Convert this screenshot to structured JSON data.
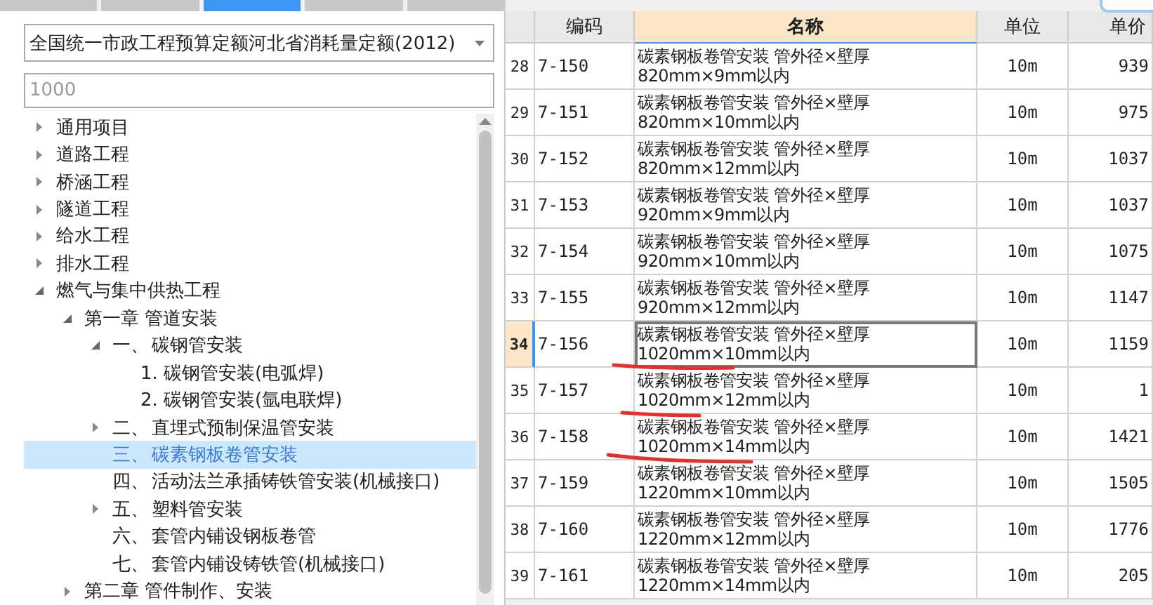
{
  "tabs": [
    {
      "selected": false
    },
    {
      "selected": false
    },
    {
      "selected": true
    },
    {
      "selected": false
    },
    {
      "selected": false
    }
  ],
  "library_select": {
    "value": "全国统一市政工程预算定额河北省消耗量定额(2012)"
  },
  "search": {
    "placeholder": "1000"
  },
  "tree": [
    {
      "label": "通用项目",
      "expanded": false,
      "has_children": true
    },
    {
      "label": "道路工程",
      "expanded": false,
      "has_children": true
    },
    {
      "label": "桥涵工程",
      "expanded": false,
      "has_children": true
    },
    {
      "label": "隧道工程",
      "expanded": false,
      "has_children": true
    },
    {
      "label": "给水工程",
      "expanded": false,
      "has_children": true
    },
    {
      "label": "排水工程",
      "expanded": false,
      "has_children": true
    },
    {
      "label": "燃气与集中供热工程",
      "expanded": true,
      "has_children": true,
      "children": [
        {
          "label": "第一章 管道安装",
          "expanded": true,
          "has_children": true,
          "children": [
            {
              "number": "一、",
              "label": "碳钢管安装",
              "expanded": true,
              "has_children": true,
              "children": [
                {
                  "label": "1. 碳钢管安装(电弧焊)",
                  "has_children": false
                },
                {
                  "label": "2. 碳钢管安装(氩电联焊)",
                  "has_children": false
                }
              ]
            },
            {
              "number": "二、",
              "label": "直埋式预制保温管安装",
              "expanded": false,
              "has_children": true
            },
            {
              "number": "三、",
              "label": "碳素钢板卷管安装",
              "has_children": false,
              "selected": true
            },
            {
              "number": "四、",
              "label": "活动法兰承插铸铁管安装(机械接口)",
              "has_children": false
            },
            {
              "number": "五、",
              "label": "塑料管安装",
              "expanded": false,
              "has_children": true
            },
            {
              "number": "六、",
              "label": "套管内铺设钢板卷管",
              "has_children": false
            },
            {
              "number": "七、",
              "label": "套管内铺设铸铁管(机械接口)",
              "has_children": false
            }
          ]
        },
        {
          "label": "第二章 管件制作、安装",
          "expanded": false,
          "has_children": true
        }
      ]
    }
  ],
  "table": {
    "columns": [
      {
        "label": "编码",
        "highlighted": false
      },
      {
        "label": "名称",
        "highlighted": true
      },
      {
        "label": "单位",
        "highlighted": false
      },
      {
        "label": "单价",
        "highlighted": false
      }
    ],
    "rows": [
      {
        "index": "28",
        "code": "7-150",
        "name": [
          "碳素钢板卷管安装 管外径×壁厚",
          "820mm×9mm以内"
        ],
        "unit": "10m",
        "price": "939",
        "selected": false
      },
      {
        "index": "29",
        "code": "7-151",
        "name": [
          "碳素钢板卷管安装 管外径×壁厚",
          "820mm×10mm以内"
        ],
        "unit": "10m",
        "price": "975",
        "selected": false
      },
      {
        "index": "30",
        "code": "7-152",
        "name": [
          "碳素钢板卷管安装 管外径×壁厚",
          "820mm×12mm以内"
        ],
        "unit": "10m",
        "price": "1037",
        "selected": false
      },
      {
        "index": "31",
        "code": "7-153",
        "name": [
          "碳素钢板卷管安装 管外径×壁厚",
          "920mm×9mm以内"
        ],
        "unit": "10m",
        "price": "1037",
        "selected": false
      },
      {
        "index": "32",
        "code": "7-154",
        "name": [
          "碳素钢板卷管安装 管外径×壁厚",
          "920mm×10mm以内"
        ],
        "unit": "10m",
        "price": "1075",
        "selected": false
      },
      {
        "index": "33",
        "code": "7-155",
        "name": [
          "碳素钢板卷管安装 管外径×壁厚",
          "920mm×12mm以内"
        ],
        "unit": "10m",
        "price": "1147",
        "selected": false
      },
      {
        "index": "34",
        "code": "7-156",
        "name": [
          "碳素钢板卷管安装 管外径×壁厚",
          "1020mm×10mm以内"
        ],
        "unit": "10m",
        "price": "1159",
        "selected": true
      },
      {
        "index": "35",
        "code": "7-157",
        "name": [
          "碳素钢板卷管安装 管外径×壁厚",
          "1020mm×12mm以内"
        ],
        "unit": "10m",
        "price": "1",
        "selected": false
      },
      {
        "index": "36",
        "code": "7-158",
        "name": [
          "碳素钢板卷管安装 管外径×壁厚",
          "1020mm×14mm以内"
        ],
        "unit": "10m",
        "price": "1421",
        "selected": false
      },
      {
        "index": "37",
        "code": "7-159",
        "name": [
          "碳素钢板卷管安装 管外径×壁厚",
          "1220mm×10mm以内"
        ],
        "unit": "10m",
        "price": "1505",
        "selected": false
      },
      {
        "index": "38",
        "code": "7-160",
        "name": [
          "碳素钢板卷管安装 管外径×壁厚",
          "1220mm×12mm以内"
        ],
        "unit": "10m",
        "price": "1776",
        "selected": false
      },
      {
        "index": "39",
        "code": "7-161",
        "name": [
          "碳素钢板卷管安装 管外径×壁厚",
          "1220mm×14mm以内"
        ],
        "unit": "10m",
        "price": "205",
        "selected": false
      }
    ]
  }
}
